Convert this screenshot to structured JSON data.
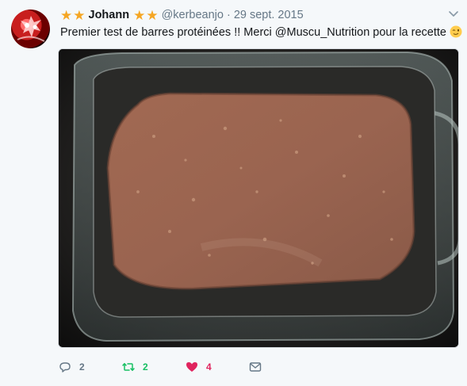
{
  "tweet": {
    "author_name": "Johann",
    "handle": "@kerbeanjo",
    "date": "29 sept. 2015",
    "text": "Premier test de barres protéinées !! Merci @Muscu_Nutrition pour la recette",
    "emoji": "winking-face",
    "image_description_icon": "photo-of-protein-bar-dough-in-glass-dish"
  },
  "actions": {
    "reply_count": "2",
    "retweet_count": "2",
    "like_count": "4"
  },
  "colors": {
    "star": "#f5a623",
    "retweet": "#17bf63",
    "like": "#e0245e",
    "secondary": "#657786"
  }
}
